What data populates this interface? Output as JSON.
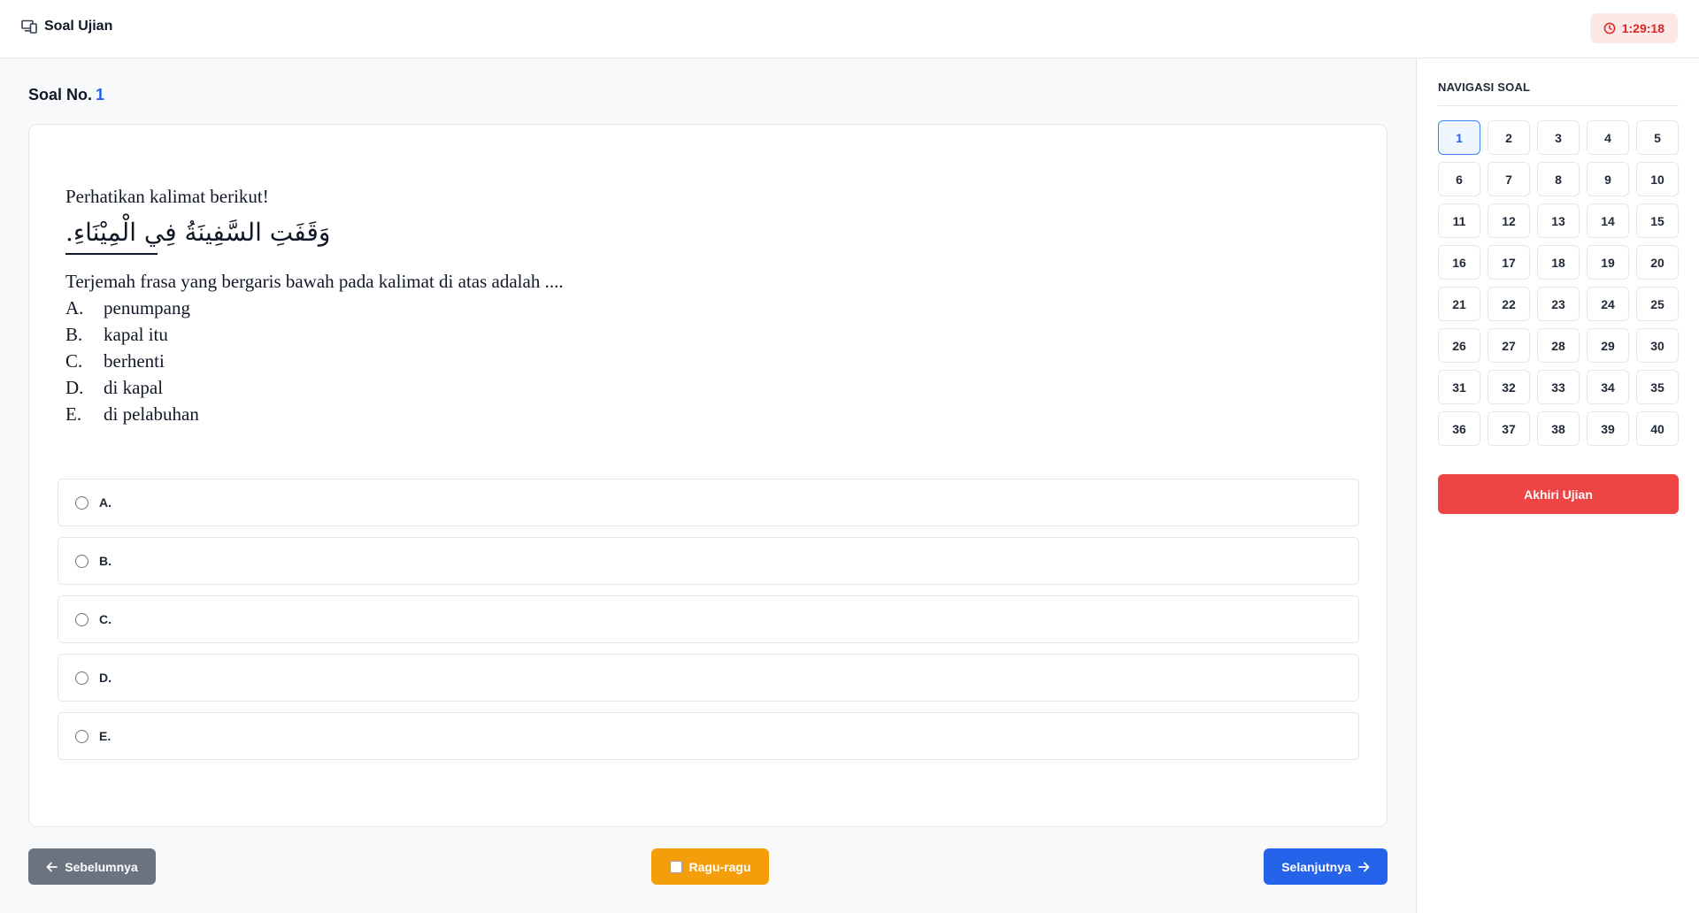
{
  "header": {
    "title": "Soal Ujian",
    "logo_icon": "monitor-phone-icon",
    "timer": "1:29:18",
    "timer_icon": "clock-icon"
  },
  "question": {
    "label": "Soal No.",
    "number": "1",
    "intro": "Perhatikan  kalimat berikut!",
    "arabic": "وَقَفَتِ السَّفِينَةُ فِي الْمِيْنَاءِ.",
    "prompt": "Terjemah frasa yang bergaris bawah pada kalimat di atas adalah ....",
    "options": [
      {
        "letter": "A.",
        "text": "penumpang"
      },
      {
        "letter": "B.",
        "text": "kapal itu"
      },
      {
        "letter": "C.",
        "text": "berhenti"
      },
      {
        "letter": "D.",
        "text": "di kapal"
      },
      {
        "letter": "E.",
        "text": "di pelabuhan"
      }
    ]
  },
  "answers": [
    "A.",
    "B.",
    "C.",
    "D.",
    "E."
  ],
  "buttons": {
    "prev": "Sebelumnya",
    "doubt": "Ragu-ragu",
    "next": "Selanjutnya"
  },
  "navigation": {
    "title": "NAVIGASI SOAL",
    "numbers": [
      "1",
      "2",
      "3",
      "4",
      "5",
      "6",
      "7",
      "8",
      "9",
      "10",
      "11",
      "12",
      "13",
      "14",
      "15",
      "16",
      "17",
      "18",
      "19",
      "20",
      "21",
      "22",
      "23",
      "24",
      "25",
      "26",
      "27",
      "28",
      "29",
      "30",
      "31",
      "32",
      "33",
      "34",
      "35",
      "36",
      "37",
      "38",
      "39",
      "40"
    ],
    "active": "1",
    "end_label": "Akhiri Ujian"
  },
  "colors": {
    "primary": "#2563eb",
    "danger": "#ef4444",
    "warning": "#f59e0b",
    "neutral": "#6b7280"
  }
}
